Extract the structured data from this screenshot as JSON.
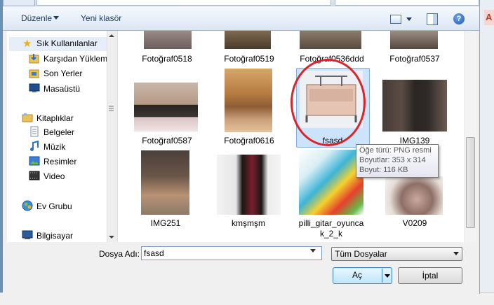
{
  "background": {
    "right_edge_text": "A"
  },
  "toolbar": {
    "organize_label": "Düzenle",
    "new_folder_label": "Yeni klasör",
    "help_glyph": "?"
  },
  "nav": {
    "favorites_label": "Sık Kullanılanlar",
    "items": [
      {
        "label": "Karşıdan Yüklem",
        "icon": "download-folder-icon"
      },
      {
        "label": "Son Yerler",
        "icon": "recent-places-icon"
      },
      {
        "label": "Masaüstü",
        "icon": "desktop-icon"
      },
      {
        "label": "Kitaplıklar",
        "icon": "libraries-icon"
      },
      {
        "label": "Belgeler",
        "icon": "documents-icon"
      },
      {
        "label": "Müzik",
        "icon": "music-icon"
      },
      {
        "label": "Resimler",
        "icon": "pictures-icon"
      },
      {
        "label": "Video",
        "icon": "video-icon"
      },
      {
        "label": "Ev Grubu",
        "icon": "homegroup-icon"
      },
      {
        "label": "Bilgisayar",
        "icon": "computer-icon"
      }
    ]
  },
  "files": [
    {
      "name": "Fotoğraf0518"
    },
    {
      "name": "Fotoğraf0519"
    },
    {
      "name": "Fotoğraf0536ddd"
    },
    {
      "name": "Fotoğraf0537"
    },
    {
      "name": "Fotoğraf0587"
    },
    {
      "name": "Fotoğraf0616"
    },
    {
      "name": "fsasd",
      "selected": true
    },
    {
      "name": "IMG139"
    },
    {
      "name": "IMG251"
    },
    {
      "name": "kmşmşm"
    },
    {
      "name_line1": "pilli_gitar_oyunca",
      "name_line2": "k_2_k"
    },
    {
      "name": "V0209"
    }
  ],
  "tooltip": {
    "type_line": "Öğe türü: PNG resmi",
    "dims_line": "Boyutlar: 353 x 314",
    "size_line": "Boyut: 116 KB"
  },
  "bottom": {
    "filename_label": "Dosya Adı:",
    "filename_value": "fsasd",
    "filter_value": "Tüm Dosyalar",
    "open_label": "Aç",
    "cancel_label": "İptal"
  },
  "colors": {
    "highlight_circle": "#d8262c",
    "selection": "#cce4fb",
    "toolbar_text": "#1e395b"
  }
}
